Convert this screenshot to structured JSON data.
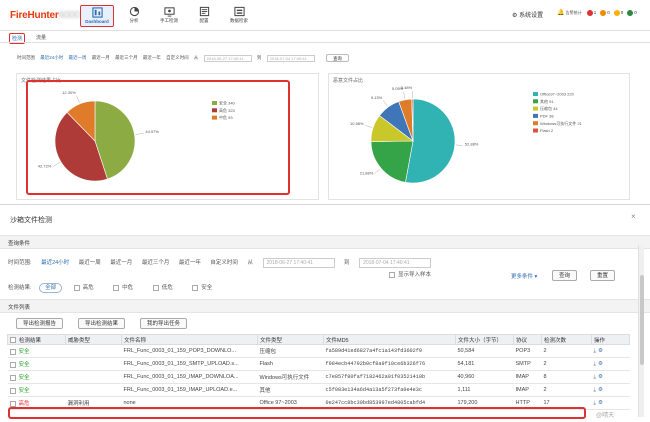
{
  "app": {
    "logo_main": "FireHunter",
    "logo_blur": "6000",
    "nav": [
      {
        "label": "Dashboard",
        "icon": "dashboard-icon",
        "active": true
      },
      {
        "label": "分析",
        "icon": "analysis-icon"
      },
      {
        "label": "手工检测",
        "icon": "manual-detect-icon"
      },
      {
        "label": "配置",
        "icon": "config-icon"
      },
      {
        "label": "数据检索",
        "icon": "data-search-icon"
      }
    ],
    "settings_label": "系统设置",
    "alarm_label": "告警统计",
    "alarm_counts": [
      "1",
      "0",
      "0",
      "0"
    ],
    "alarm_colors": [
      "#e03131",
      "#f08c00",
      "#fab005",
      "#2b8a3e"
    ]
  },
  "subtabs": [
    "检测",
    "流量"
  ],
  "filter_top": {
    "label": "时间范围",
    "options": [
      "最近24小时",
      "最近一周",
      "最近一月",
      "最近三个月",
      "最近一年",
      "自定义时间"
    ],
    "from_label": "从",
    "from_value": "2018-06-27 17:40:41",
    "to_label": "到",
    "to_value": "2018-07-04 17:40:41",
    "query": "查询"
  },
  "pie1": {
    "title": "文件检测结果占比",
    "slices": [
      {
        "label": "安全 340",
        "value": 44.97,
        "pct": "44.97%",
        "color": "#8cac43"
      },
      {
        "label": "高危 323",
        "value": 42.72,
        "pct": "42.72%",
        "color": "#ae3b38"
      },
      {
        "label": "中危 93",
        "value": 12.3,
        "pct": "12.30%",
        "color": "#e07b2a"
      }
    ]
  },
  "pie2": {
    "title": "恶意文件占比",
    "slices": [
      {
        "label": "Office97~2003 220",
        "value": 52.88,
        "pct": "52.88%",
        "color": "#31b3b3"
      },
      {
        "label": "其他 91",
        "value": 21.88,
        "pct": "21.88%",
        "color": "#35a347"
      },
      {
        "label": "压缩包 44",
        "value": 10.58,
        "pct": "10.58%",
        "color": "#c9c72a"
      },
      {
        "label": "PDF 38",
        "value": 9.13,
        "pct": "9.13%",
        "color": "#3f76b8"
      },
      {
        "label": "Windows可执行文件 21",
        "value": 5.05,
        "pct": "5.05%",
        "color": "#e07b2a"
      },
      {
        "label": "Flash 2",
        "value": 0.48,
        "pct": "0.48%",
        "color": "#d9533b"
      }
    ]
  },
  "dialog": {
    "title": "沙箱文件检测",
    "close": "×",
    "query_section": "查询条件",
    "time_label": "时间范围:",
    "time_options": [
      "最近24小时",
      "最近一周",
      "最近一月",
      "最近三个月",
      "最近一年",
      "自定义时间"
    ],
    "from_label": "从",
    "from_value": "2018-06-27 17:40:41",
    "to_label": "到",
    "to_value": "2018-07-04 17:40:41",
    "show_import": "显示导入样本",
    "result_label": "检测结果:",
    "result_options": [
      "全部",
      "高危",
      "中危",
      "低危",
      "安全"
    ],
    "more": "更多条件",
    "query": "查询",
    "reset": "重置",
    "list_section": "文件列表",
    "actions": [
      "导出检测报告",
      "导出检测结果",
      "我的导出任务"
    ],
    "columns": [
      "检测结果",
      "威胁类型",
      "文件名称",
      "文件类型",
      "文件MD5",
      "文件大小（字节）",
      "协议",
      "检测次数",
      "操作"
    ],
    "rows": [
      [
        "安全",
        "",
        "FRL_Func_0003_01_159_POP3_DOWNLO...",
        "压缩包",
        "fa589d41ed6827a4fc1a143fd3602f9",
        "50,584",
        "POP3",
        "2"
      ],
      [
        "安全",
        "",
        "FRL_Func_0003_01_159_SMTP_UPLOAD.s...",
        "Flash",
        "f984ecb44792b0cf8a9f10ce6b326f76",
        "54,181",
        "SMTP",
        "2"
      ],
      [
        "安全",
        "",
        "FRL_Func_0003_01_159_IMAP_DOWNLOA...",
        "Windows可执行文件",
        "c7e857f80faf7182462a91f03521410b",
        "40,960",
        "IMAP",
        "8"
      ],
      [
        "安全",
        "",
        "FRL_Func_0003_01_159_IMAP_UPLOAD.e...",
        "其他",
        "c5f083e134a6d4a13a5f273fa0e4e3c",
        "1,111",
        "IMAP",
        "2"
      ],
      [
        "高危",
        "漏洞利用",
        "none",
        "Office 97~2003",
        "0e247cc8bc30bd853997ed4805cabfd4",
        "179,200",
        "HTTP",
        "17"
      ]
    ],
    "watermark": "@晴天"
  }
}
